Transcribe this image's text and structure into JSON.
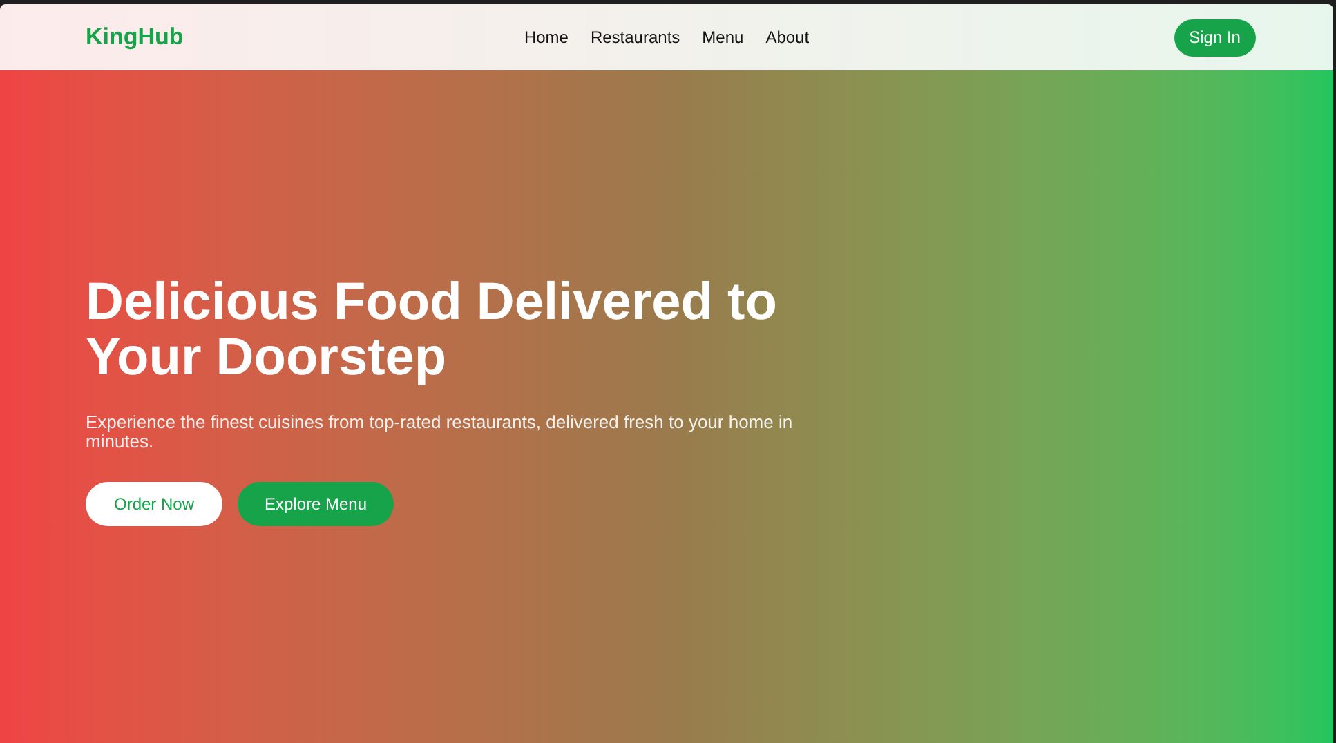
{
  "header": {
    "logo": "KingHub",
    "nav": [
      {
        "label": "Home"
      },
      {
        "label": "Restaurants"
      },
      {
        "label": "Menu"
      },
      {
        "label": "About"
      }
    ],
    "sign_in": "Sign In"
  },
  "hero": {
    "title": "Delicious Food Delivered to Your Doorstep",
    "subtitle": "Experience the finest cuisines from top-rated restaurants, delivered fresh to your home in minutes.",
    "buttons": [
      {
        "label": "Order Now",
        "kind": "light"
      },
      {
        "label": "Explore Menu",
        "kind": "solid"
      }
    ]
  }
}
